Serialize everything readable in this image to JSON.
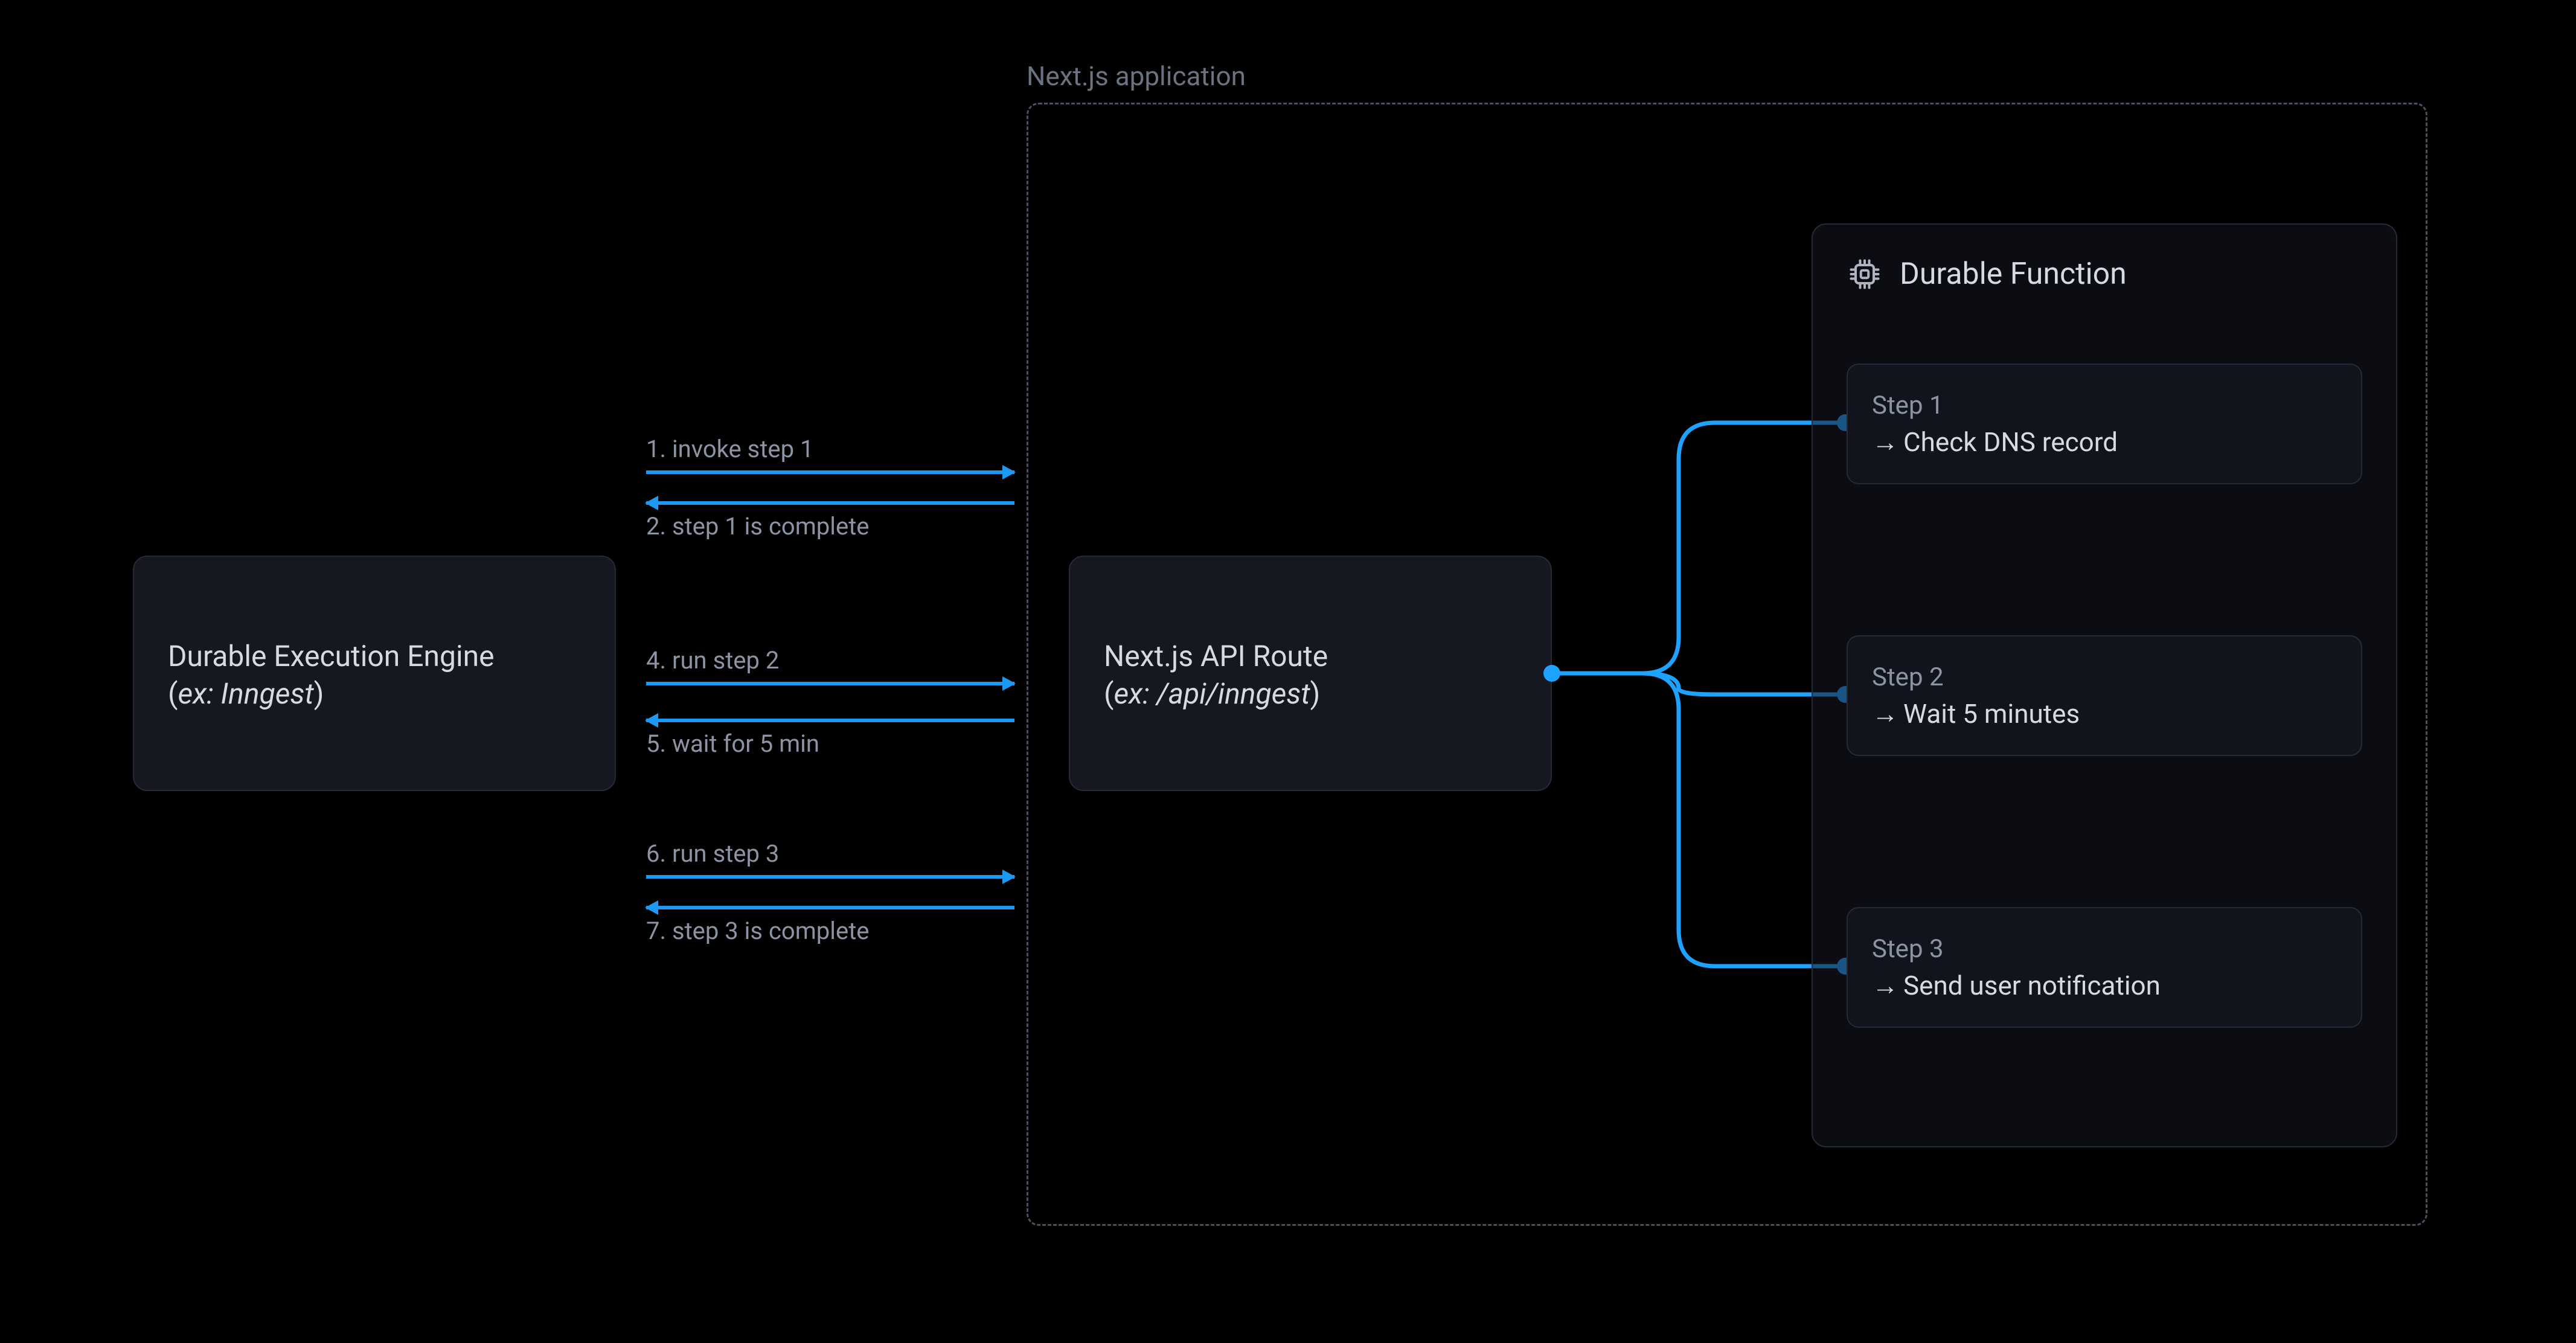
{
  "engine": {
    "title": "Durable Execution Engine",
    "example_prefix": "(",
    "example_label": "ex: Inngest",
    "example_suffix": ")"
  },
  "app": {
    "label": "Next.js application"
  },
  "api": {
    "title": "Next.js API Route",
    "example_prefix": "(",
    "example_label": "ex: /api/inngest",
    "example_suffix": ")"
  },
  "fn": {
    "title": "Durable Function",
    "icon": "cpu-icon",
    "steps": [
      {
        "title": "Step 1",
        "body": "Check DNS record"
      },
      {
        "title": "Step 2",
        "body": "Wait 5 minutes"
      },
      {
        "title": "Step 3",
        "body": "Send user notification"
      }
    ]
  },
  "messages": [
    {
      "n": "1",
      "text": "1. invoke step 1",
      "dir": "right"
    },
    {
      "n": "2",
      "text": "2. step 1 is complete",
      "dir": "left"
    },
    {
      "n": "4",
      "text": "4. run step 2",
      "dir": "right"
    },
    {
      "n": "5",
      "text": "5. wait for 5 min",
      "dir": "left"
    },
    {
      "n": "6",
      "text": "6. run step 3",
      "dir": "right"
    },
    {
      "n": "7",
      "text": "7. step 3 is complete",
      "dir": "left"
    }
  ],
  "glyphs": {
    "arrow": "→"
  },
  "colors": {
    "accent": "#1ea2ff",
    "panel": "#151821",
    "panel_border": "#252a38",
    "bg": "#000000"
  }
}
